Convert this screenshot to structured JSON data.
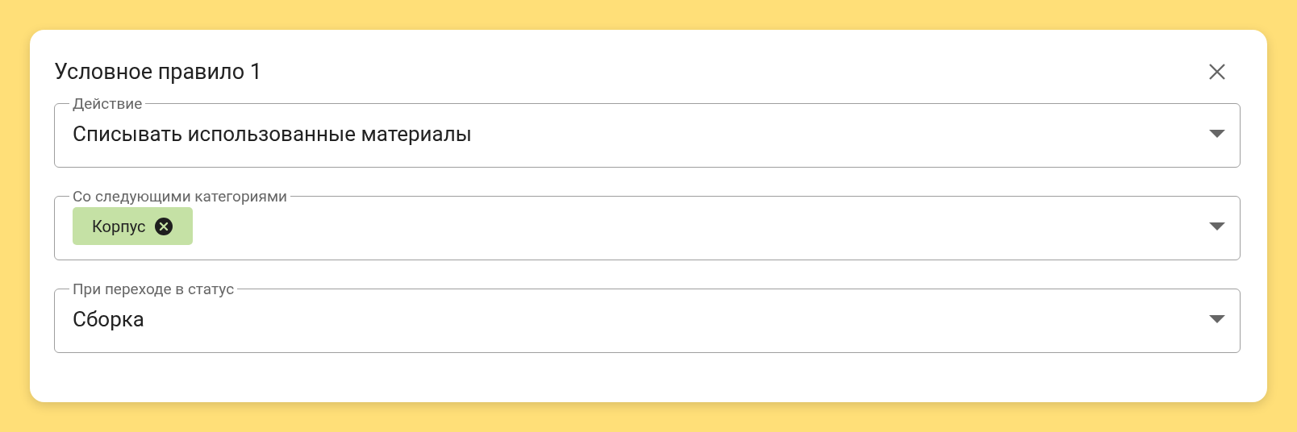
{
  "dialog": {
    "title": "Условное правило 1"
  },
  "fields": [
    {
      "kind": "select",
      "label": "Действие",
      "value": "Списывать использованные материалы"
    },
    {
      "kind": "chips",
      "label": "Со следующими категориями",
      "chips": [
        {
          "label": "Корпус",
          "color": "#c5e1a5"
        }
      ]
    },
    {
      "kind": "select",
      "label": "При переходе в статус",
      "value": "Сборка"
    }
  ]
}
